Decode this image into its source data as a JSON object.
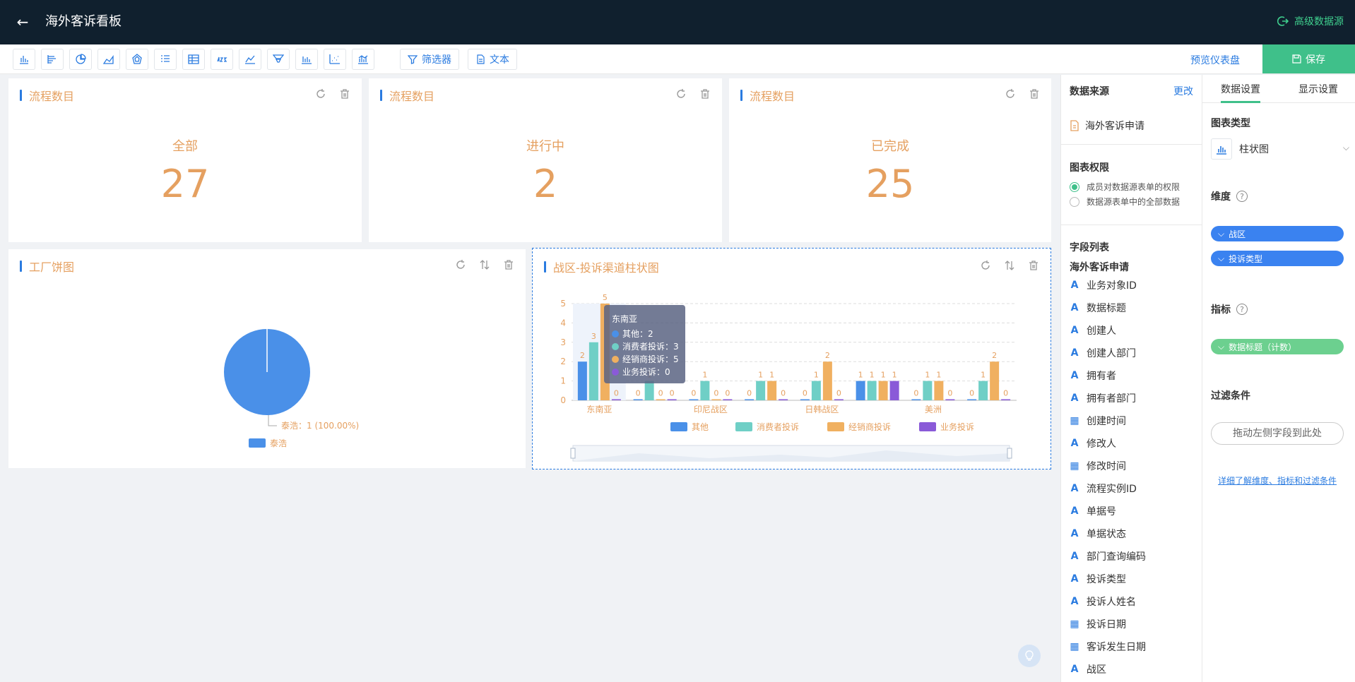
{
  "header": {
    "title": "海外客诉看板",
    "datasource_label": "高级数据源"
  },
  "toolbar": {
    "icons": [
      "bar-chart-icon",
      "horizontal-bar-icon",
      "pie-chart-icon",
      "area-chart-icon",
      "radar-chart-icon",
      "list-table-icon",
      "table-icon",
      "number-icon",
      "line-chart-icon",
      "funnel-icon",
      "column-chart-icon",
      "scatter-icon",
      "combo-chart-icon"
    ],
    "filter_label": "筛选器",
    "text_label": "文本",
    "preview_label": "预览仪表盘",
    "save_label": "保存"
  },
  "kpis": [
    {
      "title": "流程数目",
      "label": "全部",
      "value": "27"
    },
    {
      "title": "流程数目",
      "label": "进行中",
      "value": "2"
    },
    {
      "title": "流程数目",
      "label": "已完成",
      "value": "25"
    }
  ],
  "pie_card": {
    "title": "工厂饼图",
    "slice_label": "泰浩：1 (100.00%)",
    "legend": "泰浩",
    "color": "#4a90e8"
  },
  "bar_card": {
    "title": "战区-投诉渠道柱状图"
  },
  "chart_data": {
    "type": "bar",
    "categories": [
      "东南亚",
      "",
      "印尼战区",
      "",
      "日韩战区",
      "",
      "美洲",
      ""
    ],
    "visible_x_labels": [
      "东南亚",
      "印尼战区",
      "日韩战区",
      "美洲"
    ],
    "series": [
      {
        "name": "其他",
        "color": "#4a90e8",
        "values": [
          2,
          0,
          0,
          0,
          0,
          1,
          0,
          0
        ]
      },
      {
        "name": "消费者投诉",
        "color": "#6fcfc6",
        "values": [
          3,
          1,
          1,
          1,
          1,
          1,
          1,
          1
        ]
      },
      {
        "name": "经销商投诉",
        "color": "#f0b060",
        "values": [
          5,
          0,
          0,
          1,
          2,
          1,
          1,
          2
        ]
      },
      {
        "name": "业务投诉",
        "color": "#8a5ad8",
        "values": [
          0,
          0,
          0,
          0,
          0,
          1,
          0,
          0
        ]
      }
    ],
    "yticks": [
      0,
      1,
      2,
      3,
      4,
      5
    ],
    "ylim": [
      0,
      5
    ],
    "tooltip": {
      "title": "东南亚",
      "rows": [
        "其他：2",
        "消费者投诉：3",
        "经销商投诉：5",
        "业务投诉：0"
      ]
    }
  },
  "middle_panel": {
    "datasource_label": "数据来源",
    "change_label": "更改",
    "datasource_name": "海外客诉申请",
    "permission_label": "图表权限",
    "permission_options": [
      "成员对数据源表单的权限",
      "数据源表单中的全部数据"
    ],
    "field_list_label": "字段列表",
    "field_group": "海外客诉申请",
    "fields": [
      {
        "name": "业务对象ID",
        "type": "A"
      },
      {
        "name": "数据标题",
        "type": "A"
      },
      {
        "name": "创建人",
        "type": "A"
      },
      {
        "name": "创建人部门",
        "type": "A"
      },
      {
        "name": "拥有者",
        "type": "A"
      },
      {
        "name": "拥有者部门",
        "type": "A"
      },
      {
        "name": "创建时间",
        "type": "date"
      },
      {
        "name": "修改人",
        "type": "A"
      },
      {
        "name": "修改时间",
        "type": "date"
      },
      {
        "name": "流程实例ID",
        "type": "A"
      },
      {
        "name": "单据号",
        "type": "A"
      },
      {
        "name": "单据状态",
        "type": "A"
      },
      {
        "name": "部门查询编码",
        "type": "A"
      },
      {
        "name": "投诉类型",
        "type": "A"
      },
      {
        "name": "投诉人姓名",
        "type": "A"
      },
      {
        "name": "投诉日期",
        "type": "date"
      },
      {
        "name": "客诉发生日期",
        "type": "date"
      },
      {
        "name": "战区",
        "type": "A"
      }
    ]
  },
  "right_panel": {
    "tab_data": "数据设置",
    "tab_display": "显示设置",
    "chart_type_label": "图表类型",
    "chart_type_value": "柱状图",
    "dimension_label": "维度",
    "dimensions": [
      "战区",
      "投诉类型"
    ],
    "metric_label": "指标",
    "metrics": [
      "数据标题（计数）"
    ],
    "filter_label": "过滤条件",
    "filter_hint": "拖动左侧字段到此处",
    "help_link": "详细了解维度、指标和过滤条件"
  }
}
